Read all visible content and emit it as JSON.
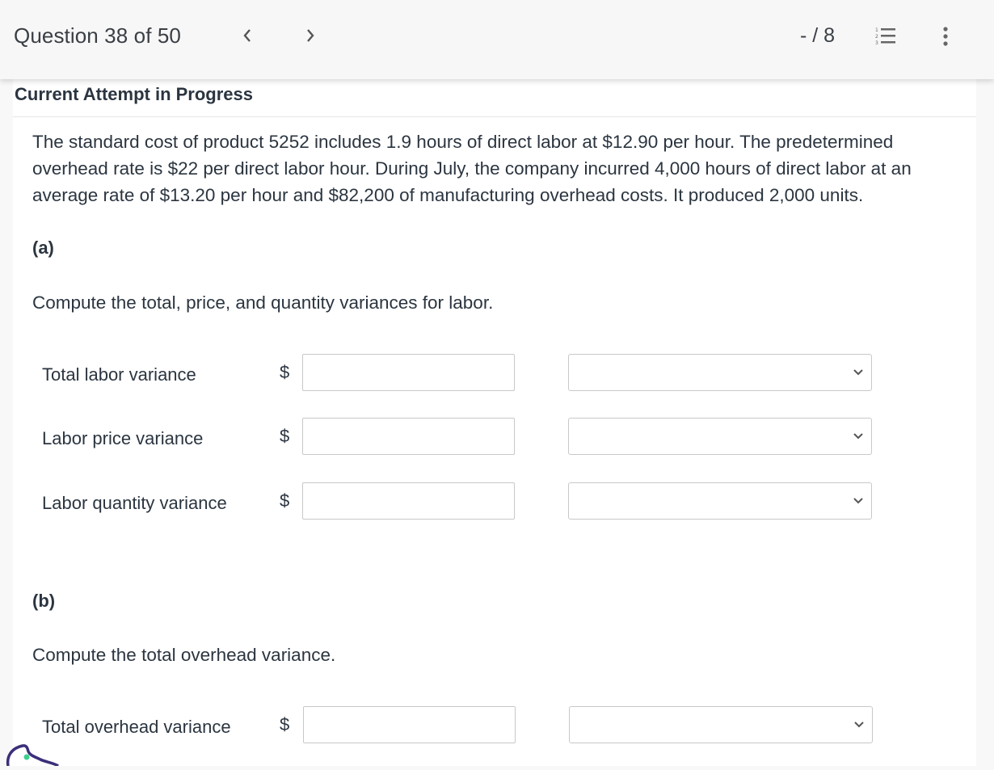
{
  "header": {
    "question_position": "Question 38 of 50",
    "score": "- / 8",
    "prev_icon": "chevron-left-icon",
    "next_icon": "chevron-right-icon",
    "list_icon": "numbered-list-icon",
    "more_icon": "more-vertical-icon"
  },
  "attempt_status": "Current Attempt in Progress",
  "problem_text": "The standard cost of product 5252 includes 1.9 hours of direct labor at $12.90 per hour. The predetermined overhead rate is $22 per direct labor hour. During July, the company incurred 4,000 hours of direct labor at an average rate of $13.20 per hour and $82,200 of manufacturing overhead costs. It produced 2,000 units.",
  "parts": [
    {
      "label": "(a)",
      "instruction": "Compute the total, price, and quantity variances for labor.",
      "rows": [
        {
          "label": "Total labor variance",
          "currency": "$",
          "amount": "",
          "selection": ""
        },
        {
          "label": "Labor price variance",
          "currency": "$",
          "amount": "",
          "selection": ""
        },
        {
          "label": "Labor quantity variance",
          "currency": "$",
          "amount": "",
          "selection": ""
        }
      ]
    },
    {
      "label": "(b)",
      "instruction": "Compute the total overhead variance.",
      "rows": [
        {
          "label": "Total overhead variance",
          "currency": "$",
          "amount": "",
          "selection": ""
        }
      ]
    }
  ],
  "colors": {
    "mascot_outline": "#3b2f7a",
    "mascot_dot": "#3ecf8e"
  }
}
